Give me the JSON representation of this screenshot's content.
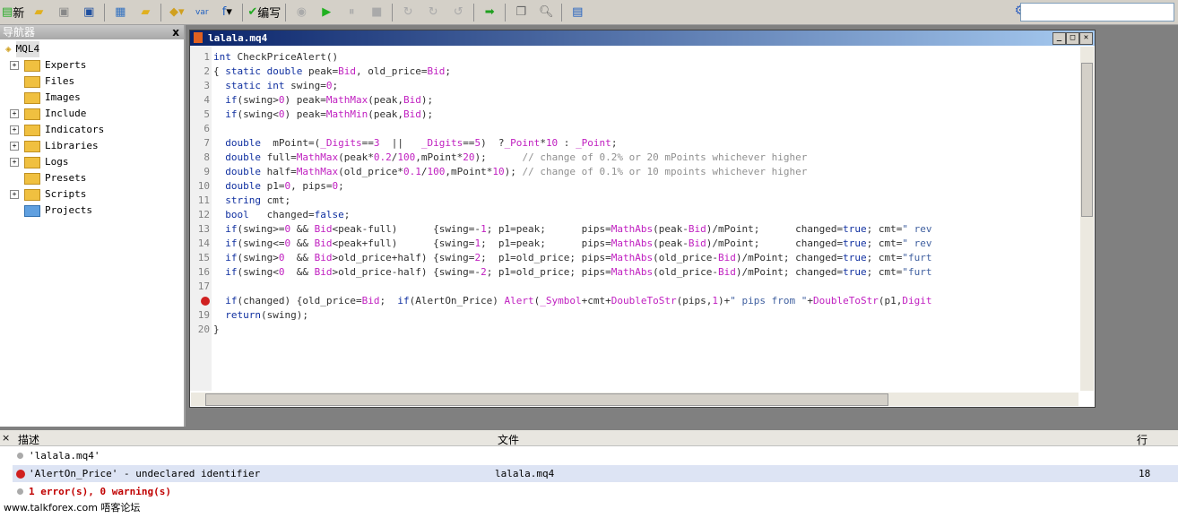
{
  "toolbar": {
    "new_label": "新",
    "compile_label": "编写",
    "icons": [
      "new-icon",
      "open-icon",
      "save-icon",
      "save-all-icon",
      "navigator-icon",
      "files-icon",
      "insert-icon",
      "var-icon",
      "function-icon",
      "compile-icon",
      "step-icon",
      "start-icon",
      "pause-icon",
      "stop-icon",
      "step-into-icon",
      "step-over-icon",
      "step-out-icon",
      "go-icon",
      "copy-icon",
      "find-icon",
      "terminal-icon"
    ],
    "var_label": "var",
    "f_label": "f"
  },
  "navigator": {
    "title": "导航器",
    "close": "x",
    "root": "MQL4",
    "items": [
      {
        "label": "Experts",
        "expand": true
      },
      {
        "label": "Files",
        "expand": false
      },
      {
        "label": "Images",
        "expand": false
      },
      {
        "label": "Include",
        "expand": true
      },
      {
        "label": "Indicators",
        "expand": true
      },
      {
        "label": "Libraries",
        "expand": true
      },
      {
        "label": "Logs",
        "expand": true
      },
      {
        "label": "Presets",
        "expand": false
      },
      {
        "label": "Scripts",
        "expand": true
      },
      {
        "label": "Projects",
        "expand": false
      }
    ]
  },
  "editor": {
    "title": "lalala.mq4",
    "error_line": 18,
    "lines": [
      "int CheckPriceAlert()",
      "{ static double peak=Bid, old_price=Bid;",
      "  static int swing=0;",
      "  if(swing>0) peak=MathMax(peak,Bid);",
      "  if(swing<0) peak=MathMin(peak,Bid);",
      "",
      "  double  mPoint=(_Digits==3  ||   _Digits==5)  ?_Point*10 : _Point;",
      "  double full=MathMax(peak*0.2/100,mPoint*20);      // change of 0.2% or 20 mPoints whichever higher",
      "  double half=MathMax(old_price*0.1/100,mPoint*10); // change of 0.1% or 10 mpoints whichever higher",
      "  double p1=0, pips=0;",
      "  string cmt;",
      "  bool   changed=false;",
      "  if(swing>=0 && Bid<peak-full)      {swing=-1; p1=peak;      pips=MathAbs(peak-Bid)/mPoint;      changed=true; cmt=\" rev",
      "  if(swing<=0 && Bid<peak+full)      {swing=1;  p1=peak;      pips=MathAbs(peak-Bid)/mPoint;      changed=true; cmt=\" rev",
      "  if(swing>0  && Bid>old_price+half) {swing=2;  p1=old_price; pips=MathAbs(old_price-Bid)/mPoint; changed=true; cmt=\"furt",
      "  if(swing<0  && Bid>old_price-half) {swing=-2; p1=old_price; pips=MathAbs(old_price-Bid)/mPoint; changed=true; cmt=\"furt",
      "",
      "  if(changed) {old_price=Bid;  if(AlertOn_Price) Alert(_Symbol+cmt+DoubleToStr(pips,1)+\" pips from \"+DoubleToStr(p1,Digit",
      "  return(swing);",
      "}"
    ]
  },
  "errors": {
    "headers": {
      "desc": "描述",
      "file": "文件",
      "line": "行"
    },
    "rows": [
      {
        "desc": "'lalala.mq4'",
        "file": "",
        "line": "",
        "type": "info"
      },
      {
        "desc": "'AlertOn_Price' - undeclared identifier",
        "file": "lalala.mq4",
        "line": "18",
        "type": "error"
      },
      {
        "desc": "1 error(s), 0 warning(s)",
        "file": "",
        "line": "",
        "type": "summary"
      }
    ],
    "close": "×"
  },
  "watermark": "www.talkforex.com 唔客论坛"
}
